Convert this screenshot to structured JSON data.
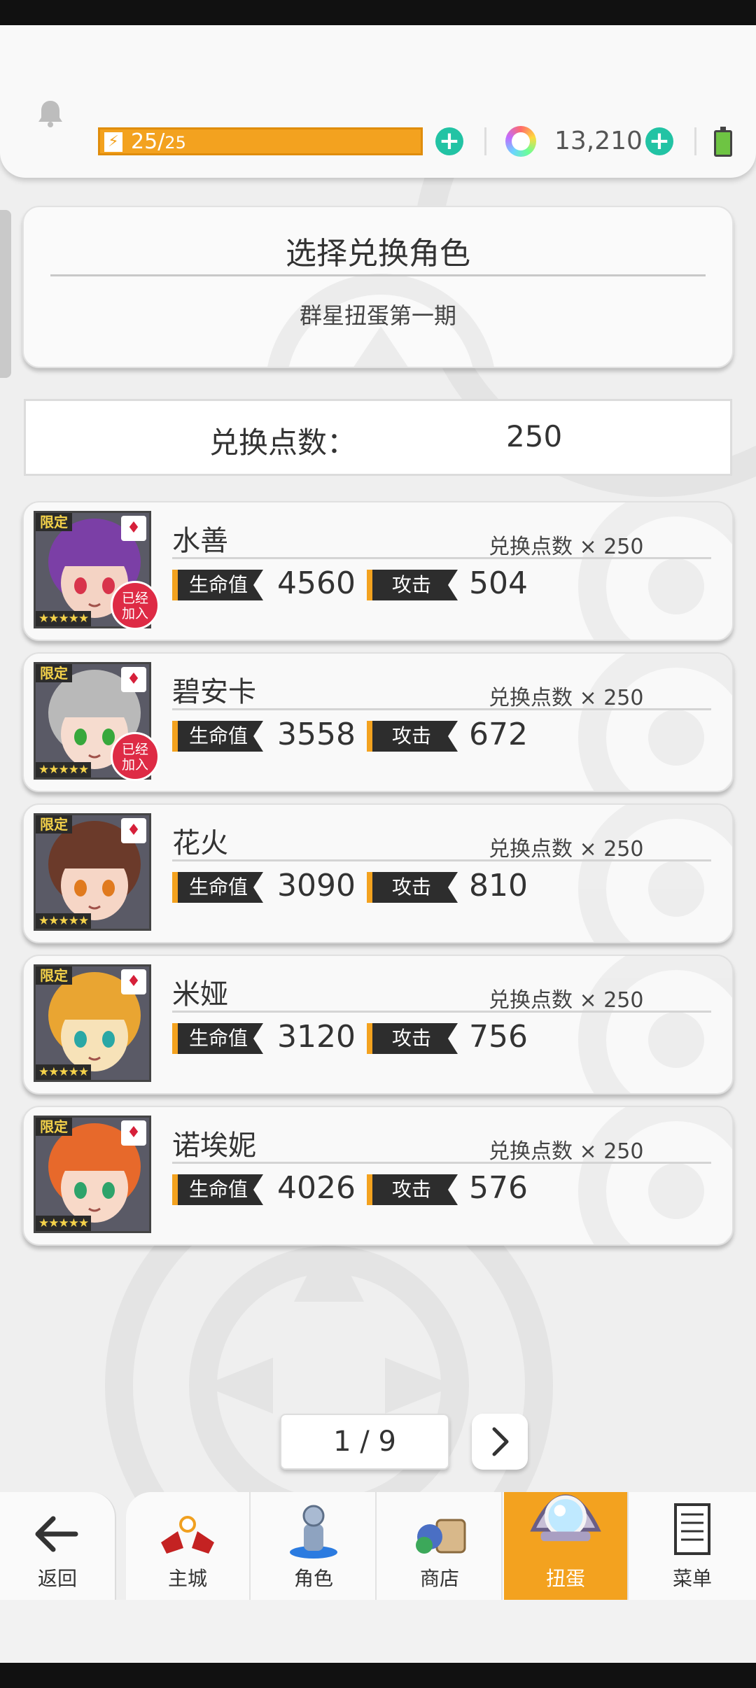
{
  "header": {
    "energy_current": "25",
    "energy_separator": "/",
    "energy_max": "25",
    "gem_count": "13,210"
  },
  "exchange": {
    "title": "选择兑换角色",
    "subtitle": "群星扭蛋第一期",
    "points_label": "兑换点数：",
    "points_value": "250"
  },
  "characters": [
    {
      "name": "水善",
      "cost": "兑换点数 × 250",
      "hp_label": "生命值",
      "hp": "4560",
      "atk_label": "攻击",
      "atk": "504",
      "limited": "限定",
      "stars": "★★★★★",
      "joined": "已经加入",
      "hair": "#7b3fa6",
      "skin": "#f4d3c4",
      "eye": "#d8344b"
    },
    {
      "name": "碧安卡",
      "cost": "兑换点数 × 250",
      "hp_label": "生命值",
      "hp": "3558",
      "atk_label": "攻击",
      "atk": "672",
      "limited": "限定",
      "stars": "★★★★★",
      "joined": "已经加入",
      "hair": "#b9b9b9",
      "skin": "#f6dccf",
      "eye": "#37a83c"
    },
    {
      "name": "花火",
      "cost": "兑换点数 × 250",
      "hp_label": "生命值",
      "hp": "3090",
      "atk_label": "攻击",
      "atk": "810",
      "limited": "限定",
      "stars": "★★★★★",
      "joined": "",
      "hair": "#6b3a2a",
      "skin": "#f6d6c6",
      "eye": "#e07a1e"
    },
    {
      "name": "米娅",
      "cost": "兑换点数 × 250",
      "hp_label": "生命值",
      "hp": "3120",
      "atk_label": "攻击",
      "atk": "756",
      "limited": "限定",
      "stars": "★★★★★",
      "joined": "",
      "hair": "#e9a532",
      "skin": "#f7e2b8",
      "eye": "#2aa7a5"
    },
    {
      "name": "诺埃妮",
      "cost": "兑换点数 × 250",
      "hp_label": "生命值",
      "hp": "4026",
      "atk_label": "攻击",
      "atk": "576",
      "limited": "限定",
      "stars": "★★★★★",
      "joined": "",
      "hair": "#e7692b",
      "skin": "#f8d9c8",
      "eye": "#2ea36a"
    }
  ],
  "pager": {
    "text": "1 / 9"
  },
  "nav": {
    "back": "返回",
    "items": [
      {
        "label": "主城",
        "icon": "castle-icon"
      },
      {
        "label": "角色",
        "icon": "character-icon"
      },
      {
        "label": "商店",
        "icon": "shop-icon"
      },
      {
        "label": "扭蛋",
        "icon": "gacha-icon"
      },
      {
        "label": "菜单",
        "icon": "menu-icon"
      }
    ]
  },
  "colors": {
    "accent": "#f3a21f",
    "plus": "#22c3a4",
    "badge": "#de2b45"
  }
}
